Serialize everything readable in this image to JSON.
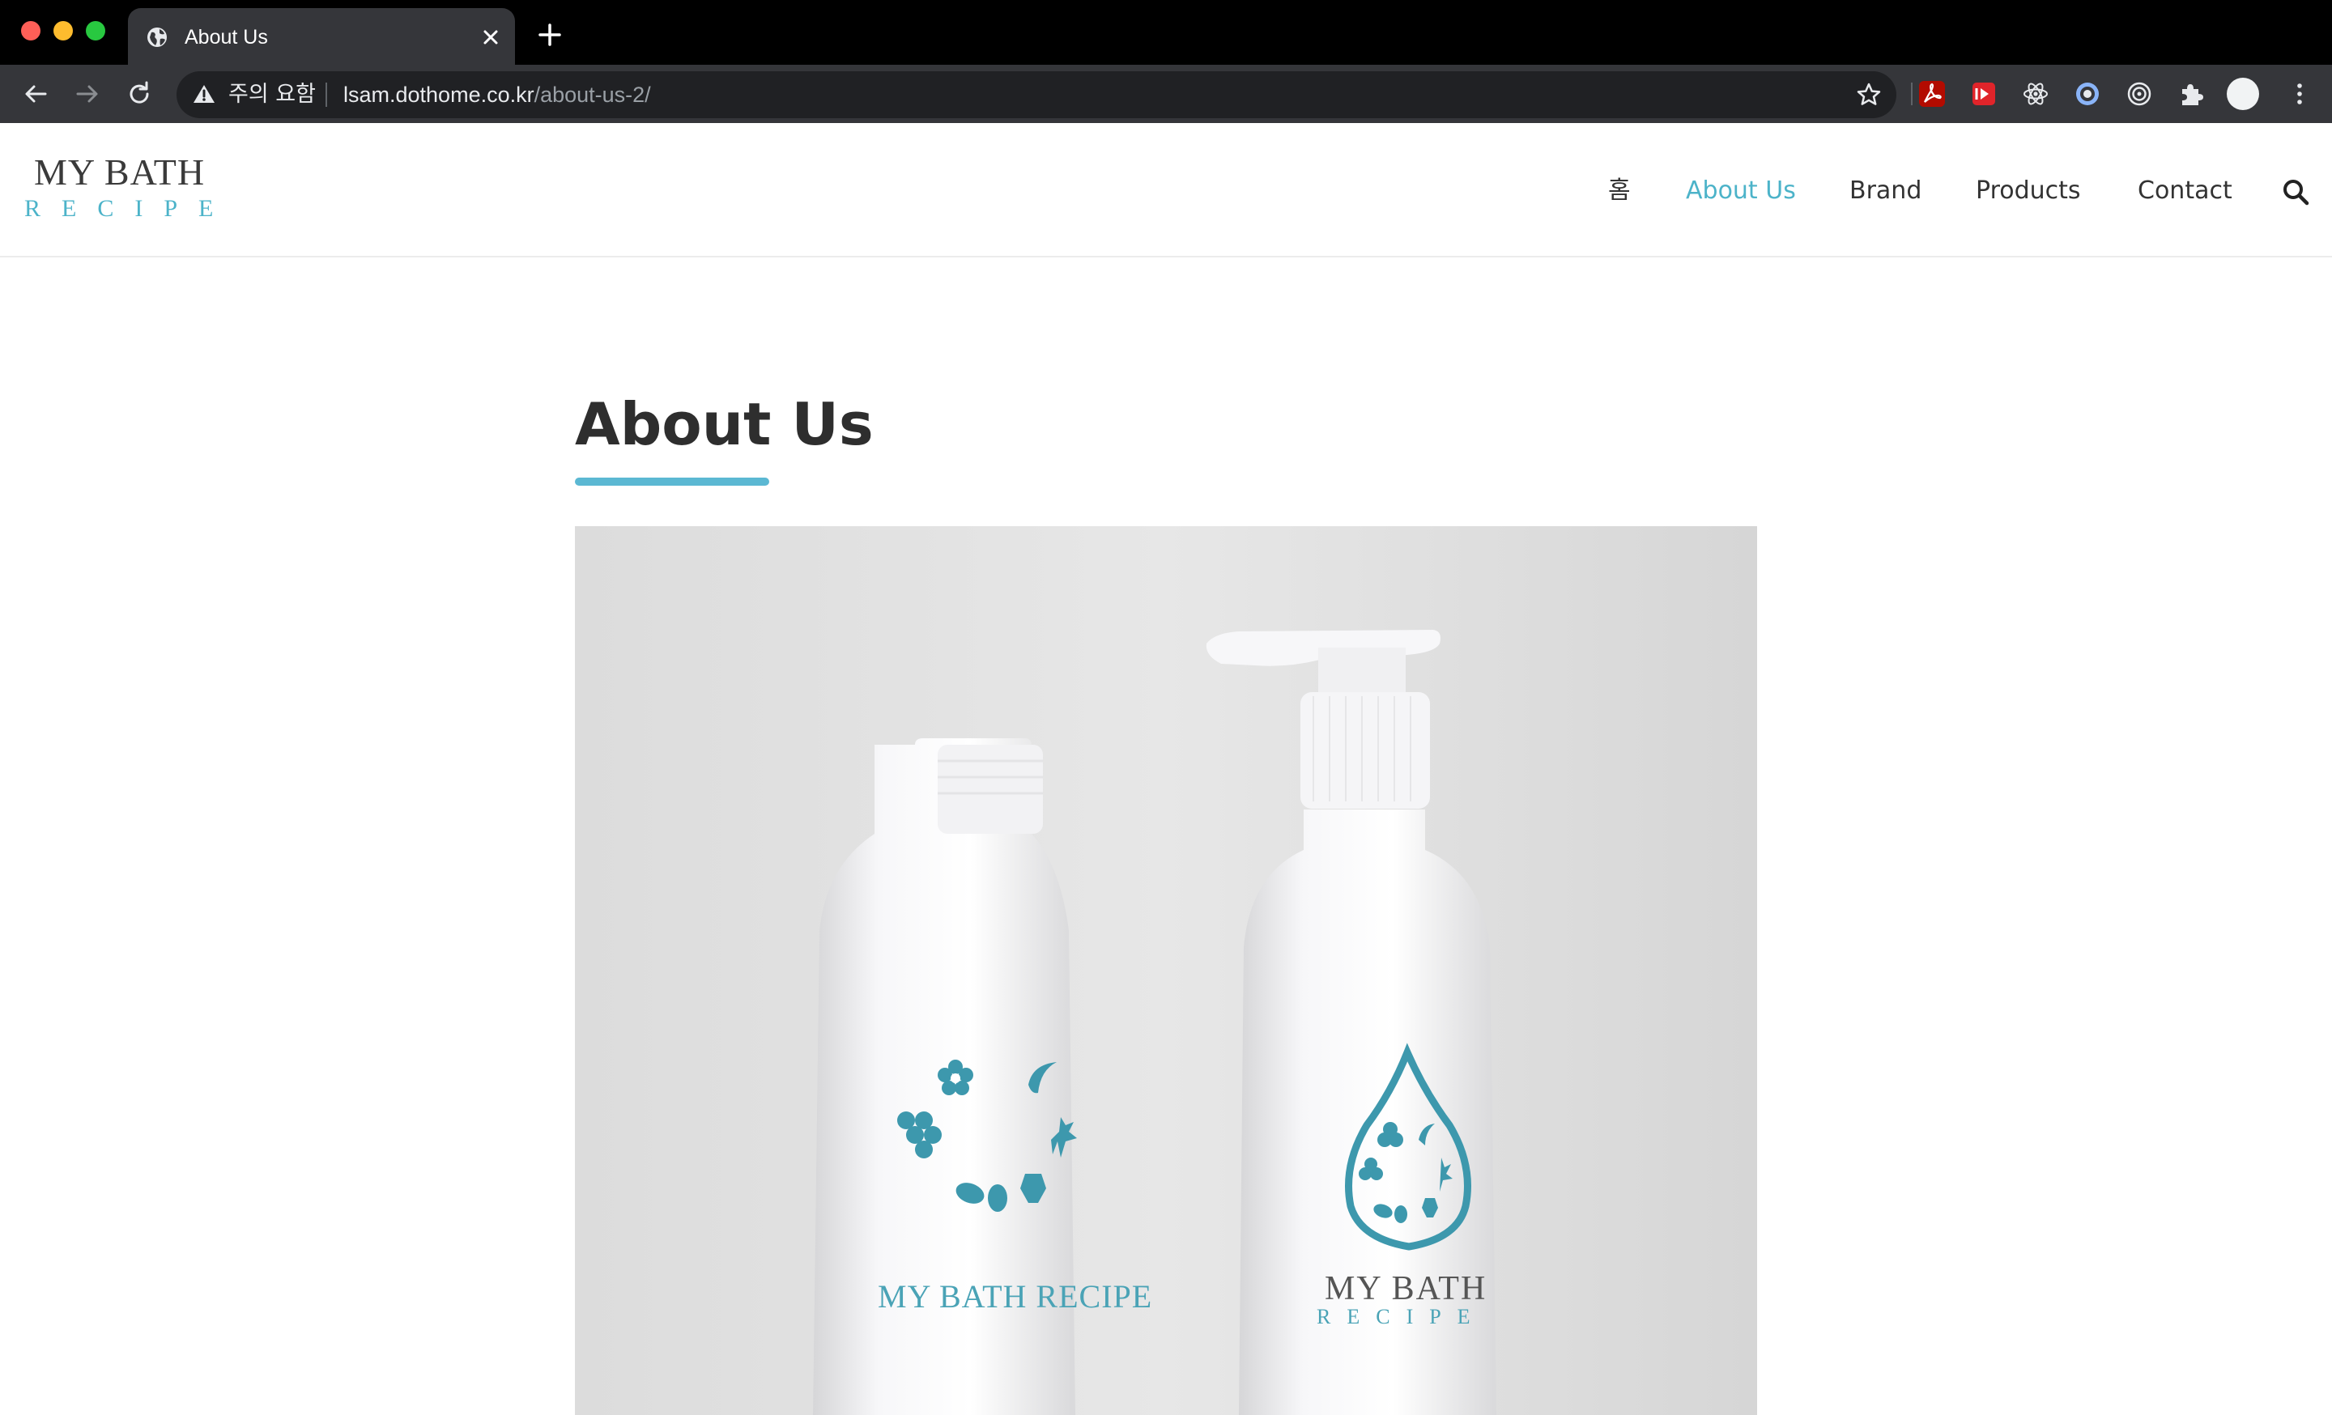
{
  "browser": {
    "tab_title": "About Us",
    "security_warning": "주의 요함",
    "url_host": "lsam.dothome.co.kr",
    "url_path": "/about-us-2/"
  },
  "site": {
    "logo": {
      "line1": "MY BATH",
      "line2": "RECIPE"
    },
    "nav": [
      {
        "label": "홈",
        "active": false
      },
      {
        "label": "About Us",
        "active": true
      },
      {
        "label": "Brand",
        "active": false
      },
      {
        "label": "Products",
        "active": false
      },
      {
        "label": "Contact",
        "active": false
      }
    ],
    "accent_color": "#4cb3c9"
  },
  "page": {
    "title": "About Us",
    "hero_image": {
      "left_bottle_label": "MY BATH RECIPE",
      "right_bottle_label_line1": "MY BATH",
      "right_bottle_label_line2": "RECIPE"
    }
  }
}
